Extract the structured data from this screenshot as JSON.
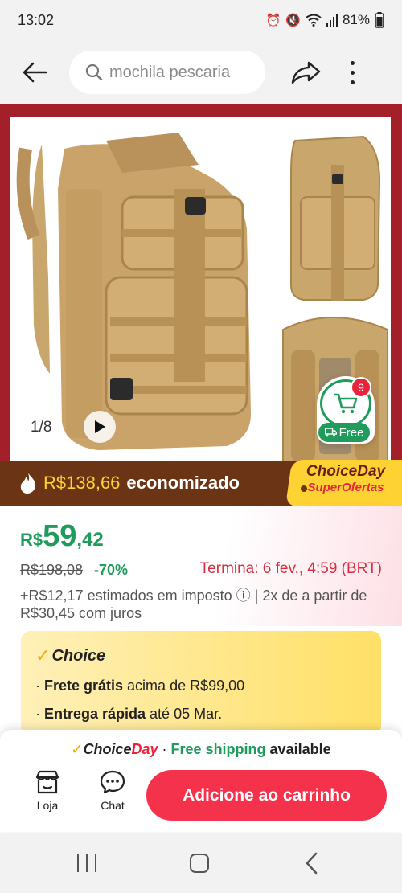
{
  "status_bar": {
    "time": "13:02",
    "battery": "81%"
  },
  "top_bar": {
    "search_text": "mochila pescaria"
  },
  "gallery": {
    "counter": "1/8",
    "cart_count": "9",
    "free_label": "Free"
  },
  "savings": {
    "amount": "R$138,66",
    "label": "economizado"
  },
  "choiceday_badge": {
    "line1": "ChoiceDay",
    "line2": "SuperOfertas"
  },
  "price": {
    "currency": "R$",
    "integer": "59",
    "cents": ",42",
    "original": "R$198,08",
    "discount": "-70%",
    "ends": "Termina:  6 fev., 4:59 (BRT)",
    "tax_note": "+R$12,17 estimados em imposto ⓘ | 2x de a partir de R$30,45 com juros"
  },
  "choice": {
    "title": "Choice",
    "line1_bold": "Frete grátis",
    "line1_rest": " acima de R$99,00",
    "line2_bold": "Entrega rápida",
    "line2_rest": " até 05 Mar."
  },
  "shipping_banner": {
    "logo_part1": "Choice",
    "logo_part2": "Day",
    "separator": " · ",
    "free_shipping": "Free shipping",
    "available": " available"
  },
  "bottom_nav": {
    "store_label": "Loja",
    "chat_label": "Chat",
    "add_to_cart": "Adicione ao carrinho"
  },
  "colors": {
    "accent_red": "#f4324c",
    "green": "#1f9b5c",
    "banner_brown": "#6b3414",
    "hero_red": "#a3202a",
    "yellow": "#ffd233"
  }
}
